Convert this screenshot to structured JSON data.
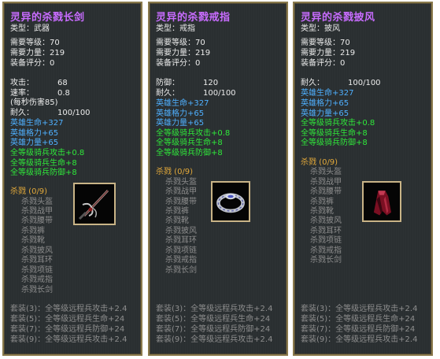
{
  "panels": [
    {
      "title": "灵异的杀戮长剑",
      "type_line": "类型：武器",
      "req_level": "需要等级：70",
      "req_str": "需要力量：219",
      "score": "装备评分：0",
      "stats": [
        {
          "label": "攻击：",
          "value": "68"
        },
        {
          "label": "速率：",
          "value": "0.8"
        }
      ],
      "dps": "(每秒伤害85)",
      "durability": {
        "label": "耐久：",
        "value": "100/100"
      },
      "blue_lines": [
        "英雄生命+327",
        "英雄格力+65",
        "英雄力量+65"
      ],
      "green_lines": [
        "全等级骑兵攻击+0.8",
        "全等级骑兵生命+8",
        "全等级骑兵防御+8"
      ],
      "set_header": "杀戮 (0/9)",
      "set_items": [
        "杀戮头盔",
        "杀戮战甲",
        "杀戮腰带",
        "杀戮裤",
        "杀戮靴",
        "杀戮披风",
        "杀戮耳环",
        "杀戮项链",
        "杀戮戒指",
        "杀戮长剑"
      ],
      "set_bonus": [
        "套装(3)：全等级远程兵攻击+2.4",
        "套装(5)：全等级远程兵生命+24",
        "套装(7)：全等级远程兵防御+24",
        "套装(9)：全等级远程兵攻击+2.4"
      ],
      "icon": "sword-icon"
    },
    {
      "title": "灵异的杀戮戒指",
      "type_line": "类型：戒指",
      "req_level": "需要等级：70",
      "req_str": "需要力量：219",
      "score": "装备评分：0",
      "stats": [
        {
          "label": "防御：",
          "value": "120"
        },
        {
          "label": "耐久：",
          "value": "100/100"
        }
      ],
      "blue_lines": [
        "英雄生命+327",
        "英雄格力+65",
        "英雄力量+65"
      ],
      "green_lines": [
        "全等级骑兵攻击+0.8",
        "全等级骑兵生命+8",
        "全等级骑兵防御+8"
      ],
      "set_header": "杀戮 (0/9)",
      "set_items": [
        "杀戮头盔",
        "杀戮战甲",
        "杀戮腰带",
        "杀戮裤",
        "杀戮靴",
        "杀戮披风",
        "杀戮耳环",
        "杀戮项链",
        "杀戮戒指",
        "杀戮长剑"
      ],
      "set_bonus": [
        "套装(3)：全等级远程兵攻击+2.4",
        "套装(5)：全等级远程兵生命+24",
        "套装(7)：全等级远程兵防御+24",
        "套装(9)：全等级远程兵攻击+2.4"
      ],
      "icon": "ring-icon"
    },
    {
      "title": "灵异的杀戮披风",
      "type_line": "类型：披风",
      "req_level": "需要等级：70",
      "req_str": "需要力量：219",
      "score": "装备评分：0",
      "stats": [
        {
          "label": "耐久：",
          "value": "100/100"
        }
      ],
      "blue_lines": [
        "英雄生命+327",
        "英雄格力+65",
        "英雄力量+65"
      ],
      "green_lines": [
        "全等级骑兵攻击+0.8",
        "全等级骑兵生命+8",
        "全等级骑兵防御+8"
      ],
      "set_header": "杀戮 (0/9)",
      "set_items": [
        "杀戮头盔",
        "杀戮战甲",
        "杀戮腰带",
        "杀戮裤",
        "杀戮靴",
        "杀戮披风",
        "杀戮耳环",
        "杀戮项链",
        "杀戮戒指",
        "杀戮长剑"
      ],
      "set_bonus": [
        "套装(3)：全等级远程兵攻击+2.4",
        "套装(5)：全等级远程兵生命+24",
        "套装(7)：全等级远程兵防御+24",
        "套装(9)：全等级远程兵攻击+2.4"
      ],
      "icon": "cloak-icon"
    }
  ],
  "colors": {
    "title": "#c86cff",
    "blue_stat": "#4fb0ff",
    "green_stat": "#2fe83a",
    "set_header": "#e3a93a",
    "inactive": "#8e8e8e",
    "frame": "#8a7a4c"
  }
}
